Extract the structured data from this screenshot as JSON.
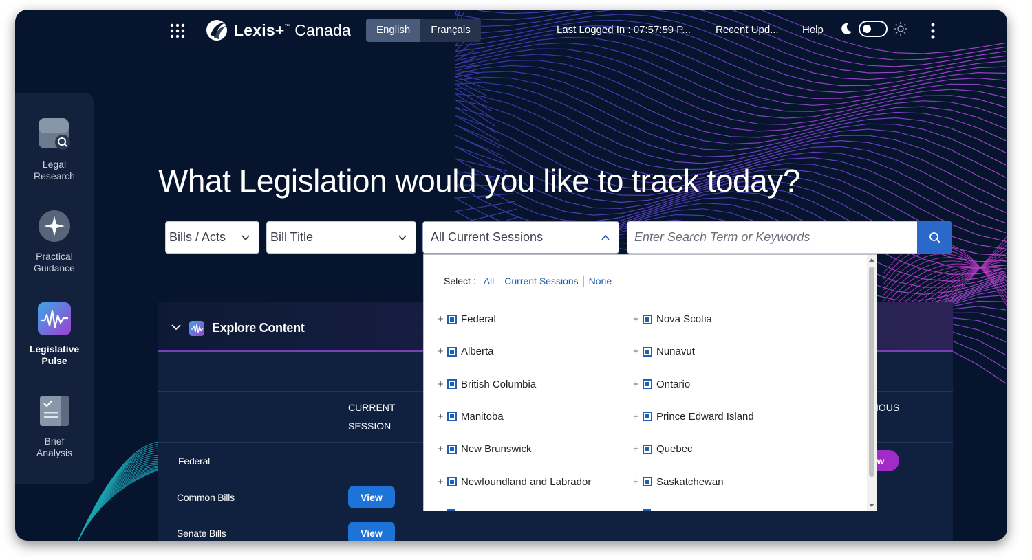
{
  "app": {
    "brand": "Lexis+",
    "brand_tm": "™",
    "brand_region": "Canada"
  },
  "topbar": {
    "languages": [
      "English",
      "Français"
    ],
    "last_logged": "Last Logged In : 07:57:59 P...",
    "recent_updates": "Recent Upd...",
    "help": "Help"
  },
  "sidebar": {
    "items": [
      {
        "label_line1": "Legal",
        "label_line2": "Research",
        "icon": "search-document-icon"
      },
      {
        "label_line1": "Practical",
        "label_line2": "Guidance",
        "icon": "compass-star-icon"
      },
      {
        "label_line1": "Legislative",
        "label_line2": "Pulse",
        "icon": "pulse-wave-icon"
      },
      {
        "label_line1": "Brief",
        "label_line2": "Analysis",
        "icon": "checklist-icon"
      }
    ]
  },
  "hero": {
    "headline": "What Legislation would you like to track today?"
  },
  "search": {
    "type_select": "Bills / Acts",
    "field_select": "Bill Title",
    "session_select": "All Current Sessions",
    "placeholder": "Enter Search Term or Keywords"
  },
  "dropdown": {
    "select_label": "Select :",
    "select_links": [
      "All",
      "Current Sessions",
      "None"
    ],
    "left_options": [
      "Federal",
      "Alberta",
      "British Columbia",
      "Manitoba",
      "New Brunswick",
      "Newfoundland and Labrador"
    ],
    "right_options": [
      "Nova Scotia",
      "Nunavut",
      "Ontario",
      "Prince Edward Island",
      "Quebec",
      "Saskatchewan"
    ]
  },
  "explore": {
    "title": "Explore Content",
    "col_current_line1": "CURRENT",
    "col_current_line2": "SESSION",
    "col_previous_fragment": "IOUS",
    "rows": [
      {
        "label": "Federal"
      },
      {
        "label": "Common Bills",
        "action": "View"
      },
      {
        "label": "Senate Bills",
        "action": "View"
      }
    ],
    "previous_view_fragment": "ew"
  },
  "colors": {
    "background": "#07142e",
    "accent_blue": "#2a68c9",
    "accent_purple": "#a12bc8",
    "link": "#1d5fb5"
  }
}
